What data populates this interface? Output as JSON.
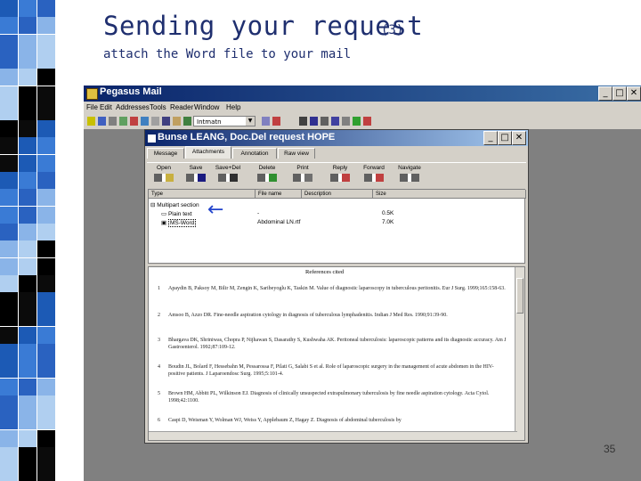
{
  "slide": {
    "title": "Sending your request",
    "title_number": "(3)",
    "subtitle": "attach the Word file to your mail",
    "page_number": "35"
  },
  "app": {
    "title": "Pegasus Mail",
    "window_buttons": [
      "_",
      "□",
      "✕"
    ],
    "menu": [
      "File",
      "Edit",
      "Addresses",
      "Tools",
      "Reader",
      "Window",
      "Help"
    ],
    "toolbar_combo": "Intmatn"
  },
  "message_window": {
    "title": "Bunse LEANG, Doc.Del request HOPE",
    "window_buttons": [
      "_",
      "□",
      "✕"
    ],
    "tabs": [
      "Message",
      "Attachments",
      "Annotation",
      "Raw view"
    ],
    "active_tab": "Attachments",
    "actions": [
      "Open",
      "Save",
      "Save+Del",
      "Delete",
      "Print",
      "Reply",
      "Forward",
      "Navigate"
    ],
    "columns": [
      "Type",
      "File name",
      "Description",
      "Size"
    ],
    "attachments": [
      {
        "type": "Multipart section",
        "name": "",
        "description": "",
        "size": ""
      },
      {
        "type": "Plain text",
        "name": "-",
        "description": "",
        "size": "0.5K"
      },
      {
        "type": "MS-Word",
        "name": "",
        "description": "Abdominal LN.rtf",
        "size": "7.0K"
      }
    ]
  },
  "document": {
    "heading": "References cited",
    "references": [
      {
        "n": "1",
        "text": "Apaydin B, Paksoy M, Bilir M, Zengin K, Saribeyoglu K, Taskin M. Value of diagnostic laparoscopy in tuberculous peritonitis. Eur J Surg. 1999;165:158-63."
      },
      {
        "n": "2",
        "text": "Amsoo B, Azzo DR. Fine-needle aspiration cytology in diagnosis of tuberculous lymphadenitis. Indian J Med Res. 1990;91:39-90."
      },
      {
        "n": "3",
        "text": "Bhargava DK, Shriniwas, Chopra P, Nijhawan S, Dasarathy S, Kushwaha AK. Peritoneal tuberculosis: laparoscopic patterns and its diagnostic accuracy. Am J Gastroenterol. 1992;87:109-12."
      },
      {
        "n": "4",
        "text": "Boudin JL, Bolard F, Hessebahn M, Pessarossa F, Pilati G, Salabi S et al. Role of laparoscopic surgery in the management of acute abdomen in the HIV-positive patients. J Laparoendosc Surg. 1995;5:101-4."
      },
      {
        "n": "5",
        "text": "Brown HM, Abbitt PL, Wilkinson EJ. Diagnosis of clinically unsuspected extrapulmonary tuberculosis by fine needle aspiration cytology. Acta Cytol. 1998;42:1100."
      },
      {
        "n": "6",
        "text": "Caspi D, Weisman Y, Wolman WJ, Weiss Y, Applebaum Z, Hagay Z. Diagnosis of abdominal tuberculosis by"
      }
    ]
  }
}
